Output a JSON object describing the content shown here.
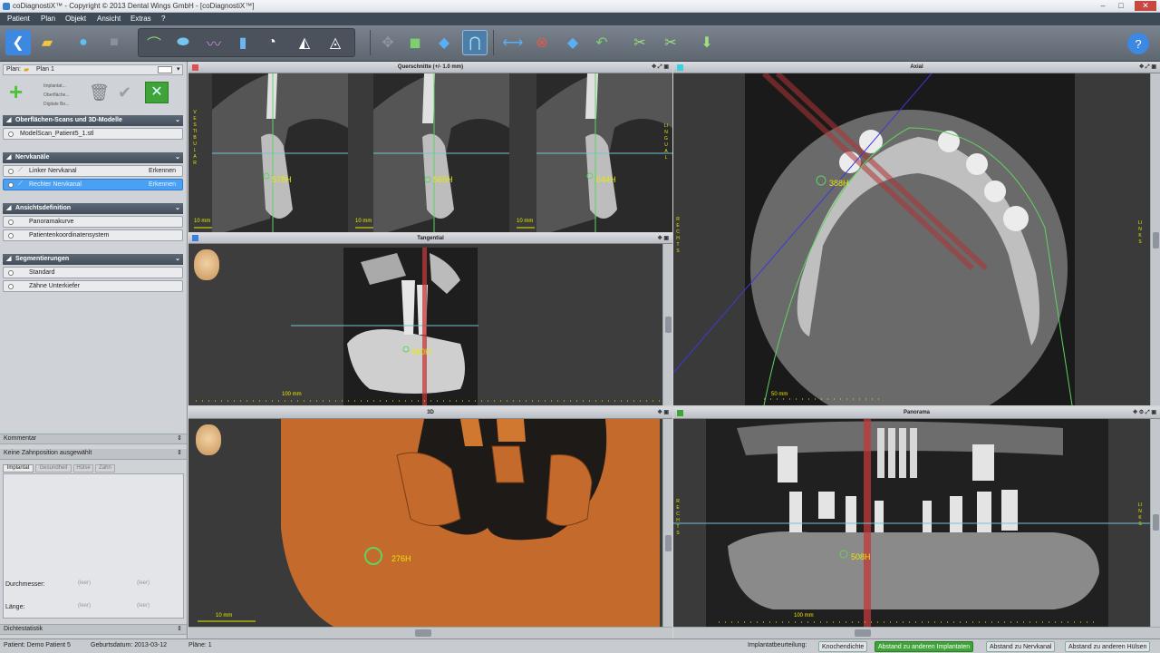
{
  "window": {
    "title": "coDiagnostiX™ - Copyright © 2013 Dental Wings GmbH - [coDiagnostiX™]"
  },
  "menu": [
    "Patient",
    "Plan",
    "Objekt",
    "Ansicht",
    "Extras",
    "?"
  ],
  "sidebar": {
    "plan_label": "Plan:",
    "plan_value": "Plan 1",
    "add_list": [
      "Implantat...",
      "Oberfläche...",
      "Digitale Bo..."
    ],
    "groups": [
      {
        "title": "Oberflächen-Scans und 3D-Modelle",
        "items": [
          {
            "label": "ModelScan_Patient5_1.stl",
            "button": ""
          }
        ]
      },
      {
        "title": "Nervkanäle",
        "items": [
          {
            "label": "Linker Nervkanal",
            "button": "Erkennen"
          },
          {
            "label": "Rechter Nervkanal",
            "button": "Erkennen"
          }
        ]
      },
      {
        "title": "Ansichtsdefinition",
        "items": [
          {
            "label": "Panoramakurve",
            "button": ""
          },
          {
            "label": "Patientenkoordinatensystem",
            "button": ""
          }
        ]
      },
      {
        "title": "Segmentierungen",
        "items": [
          {
            "label": "Standard",
            "button": ""
          },
          {
            "label": "Zähne Unterkiefer",
            "button": ""
          }
        ]
      }
    ],
    "comment_title": "Kommentar",
    "tooth_title": "Keine Zahnposition ausgewählt",
    "tabs": [
      "Implantat",
      "Gesundheit",
      "Hülse",
      "Zahn"
    ],
    "diameter_label": "Durchmesser:",
    "length_label": "Länge:",
    "field_placeholder": "(leer)",
    "density_title": "Dichtestatistik"
  },
  "views": {
    "cross": {
      "title": "Querschnitte (+/- 1.0 mm)",
      "scale": "10 mm",
      "hu": [
        "578H",
        "565H",
        "644H"
      ],
      "left_letters": "VESTIBULAR",
      "right_letters": "LINGUAL"
    },
    "tangential": {
      "title": "Tangential",
      "scale": "100 mm",
      "hu": "460H"
    },
    "axial": {
      "title": "Axial",
      "scale": "50 mm",
      "hu": "388H",
      "left_letters": "RECHTS",
      "right_letters": "LINKS"
    },
    "three_d": {
      "title": "3D",
      "scale": "10 mm",
      "hu": "276H"
    },
    "panorama": {
      "title": "Panorama",
      "scale": "100 mm",
      "hu": "508H",
      "left_letters": "RECHTS",
      "right_letters": "LINKS"
    }
  },
  "status": {
    "patient": "Patient: Demo Patient 5",
    "birth": "Geburtsdatum: 2013-03-12",
    "plans": "Pläne: 1",
    "implant_label": "Implantatbeurteilung:",
    "btn_bone": "Knochendichte",
    "btn_implants": "Abstand zu anderen Implantaten",
    "btn_nerve": "Abstand zu Nervkanal",
    "btn_sleeves": "Abstand zu anderen Hülsen"
  },
  "colors": {
    "accent": "#4aa0f2",
    "hu": "#e8e800",
    "bone3d": "#c46a2c",
    "green_btn": "#3fa33a"
  }
}
